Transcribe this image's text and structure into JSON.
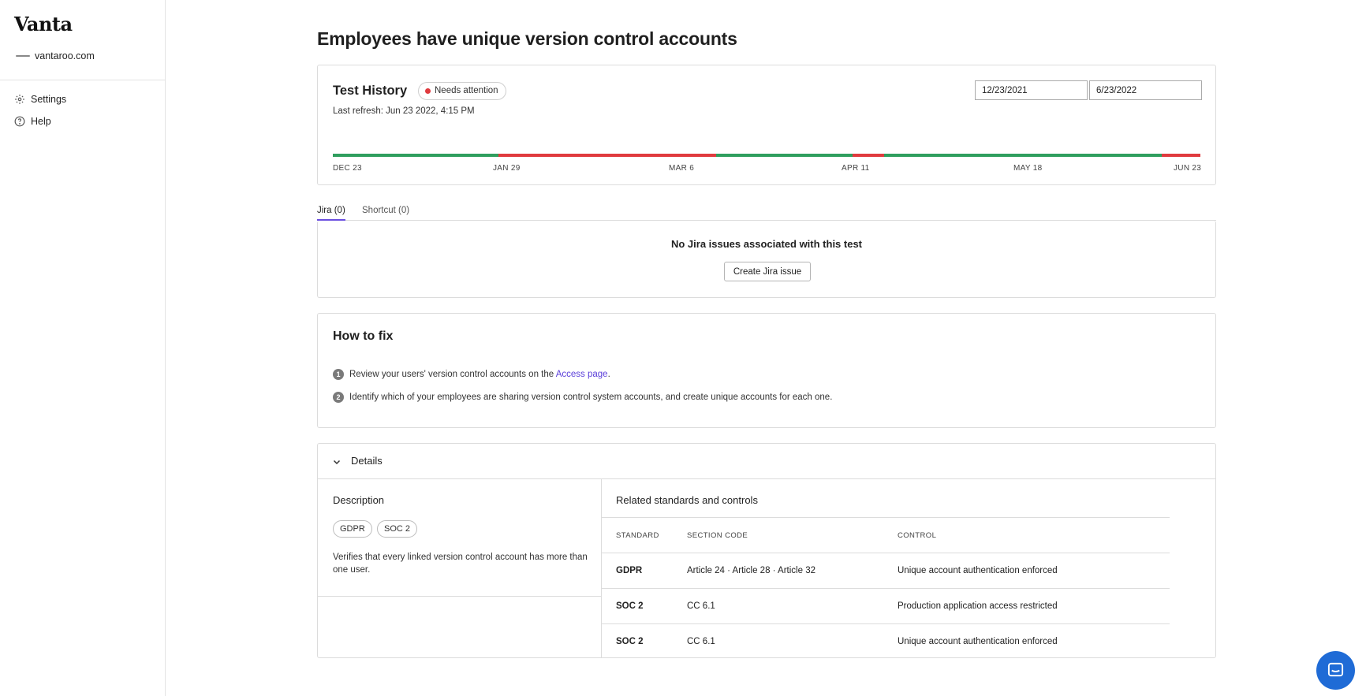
{
  "sidebar": {
    "logo": "Vanta",
    "org": "vantaroo.com",
    "items": [
      {
        "label": "Settings",
        "icon": "gear-icon"
      },
      {
        "label": "Help",
        "icon": "help-circle-icon"
      }
    ]
  },
  "page": {
    "title": "Employees have unique version control accounts"
  },
  "history": {
    "title": "Test History",
    "status": "Needs attention",
    "status_color": "#e03a3e",
    "last_refresh": "Last refresh: Jun 23 2022, 4:15 PM",
    "start_date": "12/23/2021",
    "end_date": "6/23/2022",
    "ticks": [
      "DEC 23",
      "JAN 29",
      "MAR 6",
      "APR 11",
      "MAY 18",
      "JUN 23"
    ],
    "colors": {
      "pass": "#2f9e5e",
      "fail": "#e03a3e"
    }
  },
  "tabs": [
    {
      "label": "Jira (0)",
      "active": true
    },
    {
      "label": "Shortcut (0)",
      "active": false
    }
  ],
  "jira": {
    "empty_message": "No Jira issues associated with this test",
    "create_label": "Create Jira issue"
  },
  "how_to_fix": {
    "title": "How to fix",
    "steps": [
      {
        "number": "1",
        "text_before": "Review your users' version control accounts on the ",
        "link": "Access page",
        "text_after": "."
      },
      {
        "number": "2",
        "text": "Identify which of your employees are sharing version control system accounts, and create unique accounts for each one."
      }
    ]
  },
  "details": {
    "title": "Details",
    "description_title": "Description",
    "tags": [
      "GDPR",
      "SOC 2"
    ],
    "description": "Verifies that every linked version control account has more than one user.",
    "related_title": "Related standards and controls",
    "columns": [
      "STANDARD",
      "SECTION CODE",
      "CONTROL"
    ],
    "rows": [
      {
        "standard": "GDPR",
        "section": "Article 24 · Article 28 · Article 32",
        "control": "Unique account authentication enforced"
      },
      {
        "standard": "SOC 2",
        "section": "CC 6.1",
        "control": "Production application access restricted"
      },
      {
        "standard": "SOC 2",
        "section": "CC 6.1",
        "control": "Unique account authentication enforced"
      }
    ]
  },
  "accent_color": "#6b4fe0",
  "chat_icon": "chat-bubble-icon"
}
